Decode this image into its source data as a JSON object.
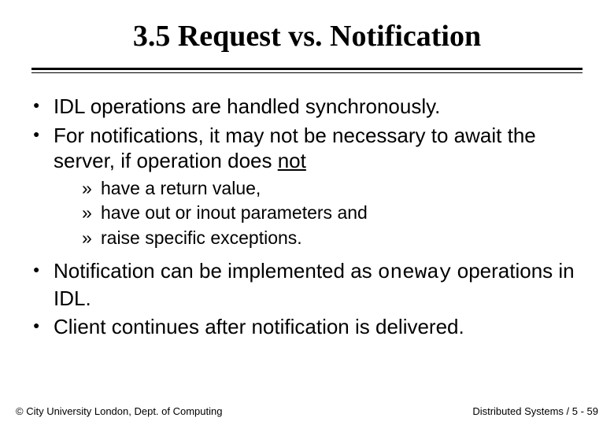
{
  "title": "3.5 Request vs. Notification",
  "bullets": {
    "b1": "IDL operations are handled synchronously.",
    "b2_pre": "For notifications, it may not be necessary to await the server, if operation does ",
    "b2_underlined": "not",
    "sub": {
      "s1": "have a return value,",
      "s2": "have out or inout parameters and",
      "s3": "raise specific exceptions."
    },
    "b3_pre": "Notification can be implemented as ",
    "b3_mono": "oneway",
    "b3_post": " operations in IDL.",
    "b4": "Client continues after notification is delivered."
  },
  "footer": {
    "left": "© City University London, Dept. of Computing",
    "right": "Distributed Systems / 5 - 59"
  }
}
